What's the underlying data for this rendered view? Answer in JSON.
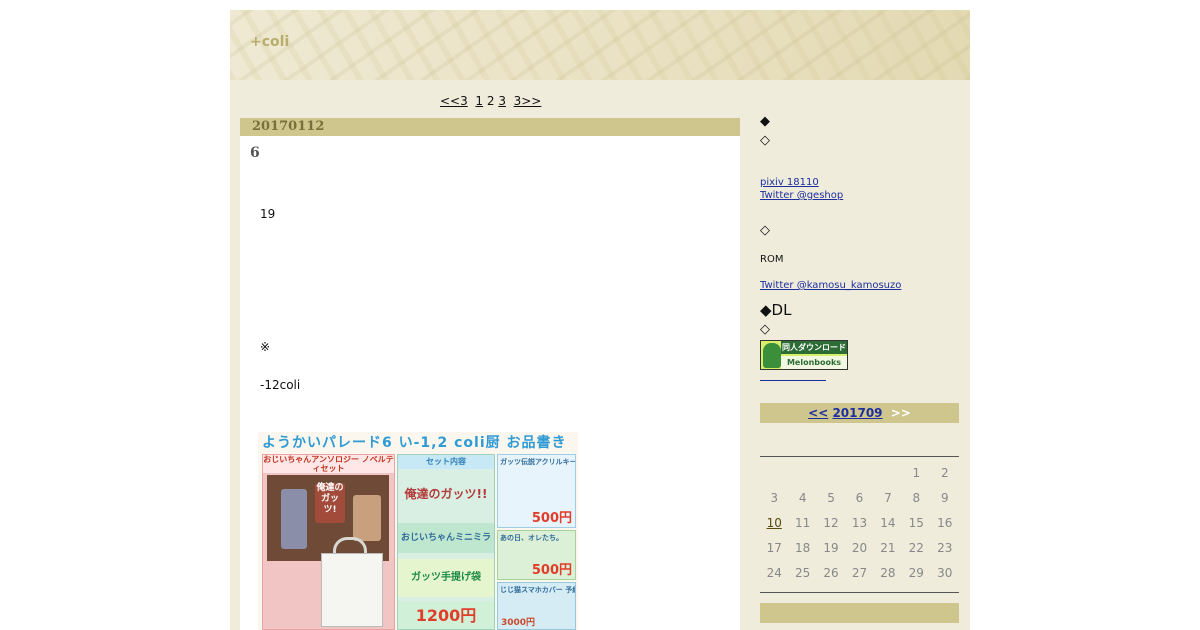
{
  "header": {
    "site_title": "+coli"
  },
  "pager": {
    "prev": "<<3",
    "p1": "1",
    "p2": "2",
    "p3": "3",
    "next": "3>>"
  },
  "post": {
    "date": "20170112",
    "title": "6",
    "paragraphs": [
      "19",
      "※",
      "-12coli"
    ],
    "flyer": {
      "header": "ようかいパレード6 い-1,2 coli厨 お品書き",
      "left_header": "おじいちゃんアンソロジー ノベルティセット",
      "left_title": "俺達のガッツ!",
      "mid_header": "セット内容",
      "mid_logo": "俺達のガッツ!!",
      "mid_mirror": "おじいちゃんミニミラー",
      "mid_bag": "ガッツ手提げ袋",
      "mid_price": "1200円",
      "r1_label": "ガッツ伝説アクリルキーホルダー",
      "r1_price": "500円",
      "r2_label": "あの日、オレたち。",
      "r2_price": "500円",
      "r3_label": "じじ猫スマホカバー 予約限定",
      "r3_price": "3000円"
    }
  },
  "sidebar": {
    "section1_mark": "◆",
    "section1_sub": "◇",
    "pixiv_link": "pixiv 18110",
    "twitter1_link": "Twitter @geshop",
    "section2_mark": "◇",
    "rom_text": "ROM",
    "twitter2_link": "Twitter @kamosu_kamosuzo",
    "dl_title": "◆DL",
    "dl_sub": "◇",
    "banner": {
      "top_text": "同人ダウンロード",
      "bottom_text": "Melonbooks DL"
    },
    "calendar": {
      "prev": "<<",
      "month": "201709",
      "next": ">>",
      "weeks": [
        [
          "",
          "",
          "",
          "",
          "",
          "1",
          "2"
        ],
        [
          "3",
          "4",
          "5",
          "6",
          "7",
          "8",
          "9"
        ],
        [
          "10",
          "11",
          "12",
          "13",
          "14",
          "15",
          "16"
        ],
        [
          "17",
          "18",
          "19",
          "20",
          "21",
          "22",
          "23"
        ],
        [
          "24",
          "25",
          "26",
          "27",
          "28",
          "29",
          "30"
        ]
      ],
      "linked_days": [
        "10"
      ]
    }
  },
  "colors": {
    "page_bg": "#efecdc",
    "bar": "#cfc68d",
    "title": "#b7ad6c",
    "link": "#1d2f9e"
  }
}
